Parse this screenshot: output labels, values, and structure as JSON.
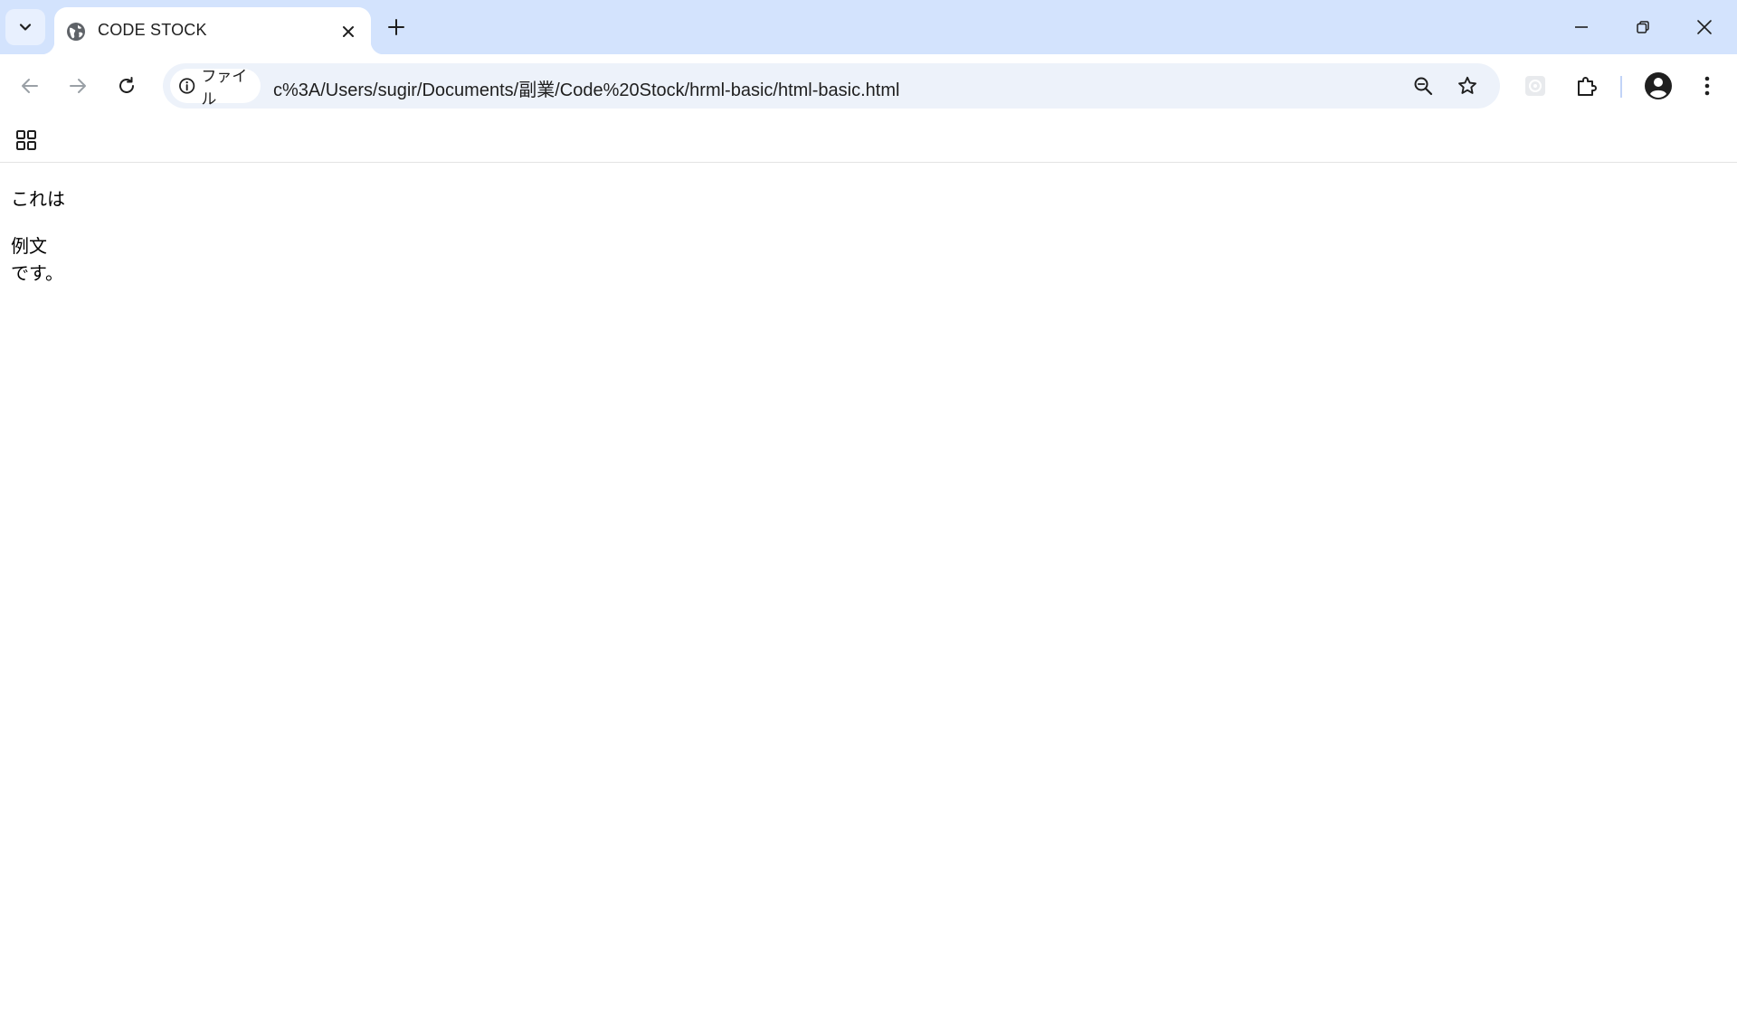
{
  "window": {
    "controls": {
      "minimize": "minimize",
      "restore": "restore",
      "close": "close"
    }
  },
  "tab": {
    "title": "CODE STOCK",
    "favicon": "globe-icon"
  },
  "toolbar": {
    "security_chip_label": "ファイル",
    "url": "c%3A/Users/sugir/Documents/副業/Code%20Stock/hrml-basic/html-basic.html"
  },
  "page": {
    "paragraph1": "これは",
    "paragraph2_line1": "例文",
    "paragraph2_line2": "です。"
  },
  "colors": {
    "tabstrip": "#d3e3fd",
    "omnibox": "#edf2fa",
    "text": "#1f1f1f"
  }
}
